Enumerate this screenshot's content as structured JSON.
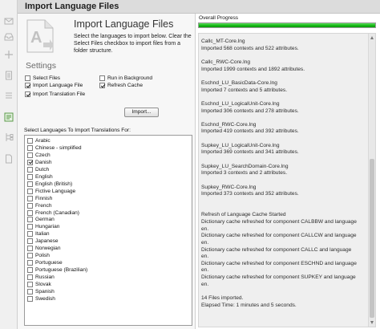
{
  "window": {
    "title": "Import Language Files"
  },
  "header": {
    "heading": "Import Language Files",
    "description": "Select the languages to import below. Clear the Select Files checkbox to import files from a folder structure.",
    "icon": "import-language-icon"
  },
  "settings": {
    "heading": "Settings",
    "select_files": {
      "label": "Select Files",
      "checked": false
    },
    "run_in_background": {
      "label": "Run in Background",
      "checked": false
    },
    "import_language_file": {
      "label": "Import Language File",
      "checked": true
    },
    "refresh_cache": {
      "label": "Refresh Cache",
      "checked": true
    },
    "import_translation_file": {
      "label": "Import Translation File",
      "checked": true
    }
  },
  "import_button": {
    "label": "Import..."
  },
  "languages": {
    "label": "Select Languages To Import Translations For:",
    "items": [
      {
        "label": "Arabic",
        "checked": false
      },
      {
        "label": "Chinese - simplified",
        "checked": false
      },
      {
        "label": "Czech",
        "checked": false
      },
      {
        "label": "Danish",
        "checked": true
      },
      {
        "label": "Dutch",
        "checked": false
      },
      {
        "label": "English",
        "checked": false
      },
      {
        "label": "English (British)",
        "checked": false
      },
      {
        "label": "Fictive Language",
        "checked": false
      },
      {
        "label": "Finnish",
        "checked": false
      },
      {
        "label": "French",
        "checked": false
      },
      {
        "label": "French (Canadian)",
        "checked": false
      },
      {
        "label": "German",
        "checked": false
      },
      {
        "label": "Hungarian",
        "checked": false
      },
      {
        "label": "Italian",
        "checked": false
      },
      {
        "label": "Japanese",
        "checked": false
      },
      {
        "label": "Norwegian",
        "checked": false
      },
      {
        "label": "Polish",
        "checked": false
      },
      {
        "label": "Portuguese",
        "checked": false
      },
      {
        "label": "Portuguese (Brazilian)",
        "checked": false
      },
      {
        "label": "Russian",
        "checked": false
      },
      {
        "label": "Slovak",
        "checked": false
      },
      {
        "label": "Spanish",
        "checked": false
      },
      {
        "label": "Swedish",
        "checked": false
      }
    ]
  },
  "progress": {
    "label": "Overall Progress",
    "percent": 100,
    "color": "#16b816"
  },
  "log": {
    "lines": [
      "Callc_MT-Core.lng",
      "Imported 568 contexts and 522 attributes.",
      "",
      "Callc_RWC-Core.lng",
      "Imported 1999 contexts and 1892 attributes.",
      "",
      "Eschnd_LU_BasicData-Core.lng",
      "Imported 7 contexts and 5 attributes.",
      "",
      "Eschnd_LU_LogicalUnit-Core.lng",
      "Imported 306 contexts and 278 attributes.",
      "",
      "Eschnd_RWC-Core.lng",
      "Imported 419 contexts and 392 attributes.",
      "",
      "Supkey_LU_LogicalUnit-Core.lng",
      "Imported 369 contexts and 341 attributes.",
      "",
      "Supkey_LU_SearchDomain-Core.lng",
      "Imported 3 contexts and 2 attributes.",
      "",
      "Supkey_RWC-Core.lng",
      "Imported 373 contexts and 352 attributes.",
      "",
      "",
      "Refresh of Language Cache Started",
      "Dictionary cache refreshed for component CALBBW and language",
      "en.",
      "Dictionary cache refreshed for component CALLCW and language",
      "en.",
      "Dictionary cache refreshed for component CALLC and language",
      "en.",
      "Dictionary cache refreshed for component ESCHND and language",
      "en.",
      "Dictionary cache refreshed for component SUPKEY and language",
      "en.",
      "",
      "14 Files imported.",
      "Elapsed Time: 1 minutes and 5 seconds."
    ]
  },
  "sidebar": {
    "icons": [
      "mail-icon",
      "inbox-icon",
      "add-icon",
      "document-icon",
      "list-icon",
      "tree-icon",
      "language-files-icon",
      "puzzle-icon",
      "page-icon"
    ]
  }
}
